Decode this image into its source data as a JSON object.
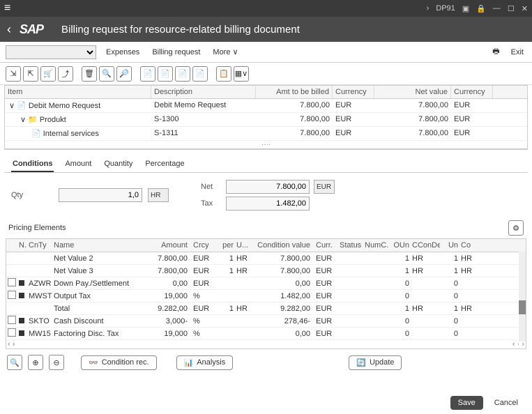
{
  "titlebar": {
    "tx": "DP91"
  },
  "header": {
    "logo": "SAP",
    "title": "Billing request for resource-related billing document"
  },
  "toolbar1": {
    "expenses": "Expenses",
    "billing": "Billing request",
    "more": "More",
    "exit": "Exit"
  },
  "tree": {
    "cols": {
      "item": "Item",
      "desc": "Description",
      "amt": "Amt to be billed",
      "cur": "Currency",
      "net": "Net value",
      "cur2": "Currency"
    },
    "rows": [
      {
        "indent": 0,
        "exp": "∨",
        "icon": "📄",
        "item": "Debit Memo Request",
        "desc": "Debit Memo Request",
        "amt": "7.800,00",
        "cur": "EUR",
        "net": "7.800,00",
        "cur2": "EUR"
      },
      {
        "indent": 1,
        "exp": "∨",
        "icon": "📁",
        "item": "Produkt",
        "desc": "S-1300",
        "amt": "7.800,00",
        "cur": "EUR",
        "net": "7.800,00",
        "cur2": "EUR"
      },
      {
        "indent": 2,
        "exp": "",
        "icon": "📄",
        "item": "Internal services",
        "desc": "S-1311",
        "amt": "7.800,00",
        "cur": "EUR",
        "net": "7.800,00",
        "cur2": "EUR"
      }
    ]
  },
  "tabs": {
    "t1": "Conditions",
    "t2": "Amount",
    "t3": "Quantity",
    "t4": "Percentage"
  },
  "qty": {
    "label": "Qty",
    "value": "1,0",
    "unit": "HR",
    "netlbl": "Net",
    "netval": "7.800,00",
    "netcur": "EUR",
    "taxlbl": "Tax",
    "taxval": "1.482,00"
  },
  "pricing": {
    "title": "Pricing Elements",
    "cols": {
      "n": "N..",
      "cnty": "CnTy",
      "name": "Name",
      "amt": "Amount",
      "crcy": "Crcy",
      "per": "per",
      "u": "U...",
      "cond": "Condition value",
      "curr": "Curr.",
      "status": "Status",
      "numc": "NumC...",
      "oun": "OUn",
      "ccond": "CConDe",
      "un": "Un",
      "co": "Co"
    },
    "rows": [
      {
        "chk": "",
        "st": "",
        "cnty": "",
        "name": "Net Value 2",
        "amt": "7.800,00",
        "crcy": "EUR",
        "per": "1",
        "u": "HR",
        "cond": "7.800,00",
        "curr": "EUR",
        "status": "",
        "numc": "",
        "oun": "1",
        "ccond": "HR",
        "un": "1",
        "co": "HR"
      },
      {
        "chk": "",
        "st": "",
        "cnty": "",
        "name": "Net Value 3",
        "amt": "7.800,00",
        "crcy": "EUR",
        "per": "1",
        "u": "HR",
        "cond": "7.800,00",
        "curr": "EUR",
        "status": "",
        "numc": "",
        "oun": "1",
        "ccond": "HR",
        "un": "1",
        "co": "HR"
      },
      {
        "chk": "y",
        "st": "b",
        "cnty": "AZWR",
        "name": "Down Pay./Settlement",
        "amt": "0,00",
        "crcy": "EUR",
        "per": "",
        "u": "",
        "cond": "0,00",
        "curr": "EUR",
        "status": "",
        "numc": "",
        "oun": "0",
        "ccond": "",
        "un": "0",
        "co": ""
      },
      {
        "chk": "y",
        "st": "b",
        "cnty": "MWST",
        "name": "Output Tax",
        "amt": "19,000",
        "crcy": "%",
        "per": "",
        "u": "",
        "cond": "1.482,00",
        "curr": "EUR",
        "status": "",
        "numc": "",
        "oun": "0",
        "ccond": "",
        "un": "0",
        "co": ""
      },
      {
        "chk": "",
        "st": "",
        "cnty": "",
        "name": "Total",
        "amt": "9.282,00",
        "crcy": "EUR",
        "per": "1",
        "u": "HR",
        "cond": "9.282,00",
        "curr": "EUR",
        "status": "",
        "numc": "",
        "oun": "1",
        "ccond": "HR",
        "un": "1",
        "co": "HR"
      },
      {
        "chk": "y",
        "st": "b",
        "cnty": "SKTO",
        "name": "Cash Discount",
        "amt": "3,000-",
        "crcy": "%",
        "per": "",
        "u": "",
        "cond": "278,46-",
        "curr": "EUR",
        "status": "",
        "numc": "",
        "oun": "0",
        "ccond": "",
        "un": "0",
        "co": ""
      },
      {
        "chk": "y",
        "st": "b",
        "cnty": "MW15",
        "name": "Factoring Disc. Tax",
        "amt": "19,000",
        "crcy": "%",
        "per": "",
        "u": "",
        "cond": "0,00",
        "curr": "EUR",
        "status": "",
        "numc": "",
        "oun": "0",
        "ccond": "",
        "un": "0",
        "co": ""
      }
    ]
  },
  "bottom": {
    "condrec": "Condition rec.",
    "analysis": "Analysis",
    "update": "Update"
  },
  "footer": {
    "save": "Save",
    "cancel": "Cancel"
  }
}
